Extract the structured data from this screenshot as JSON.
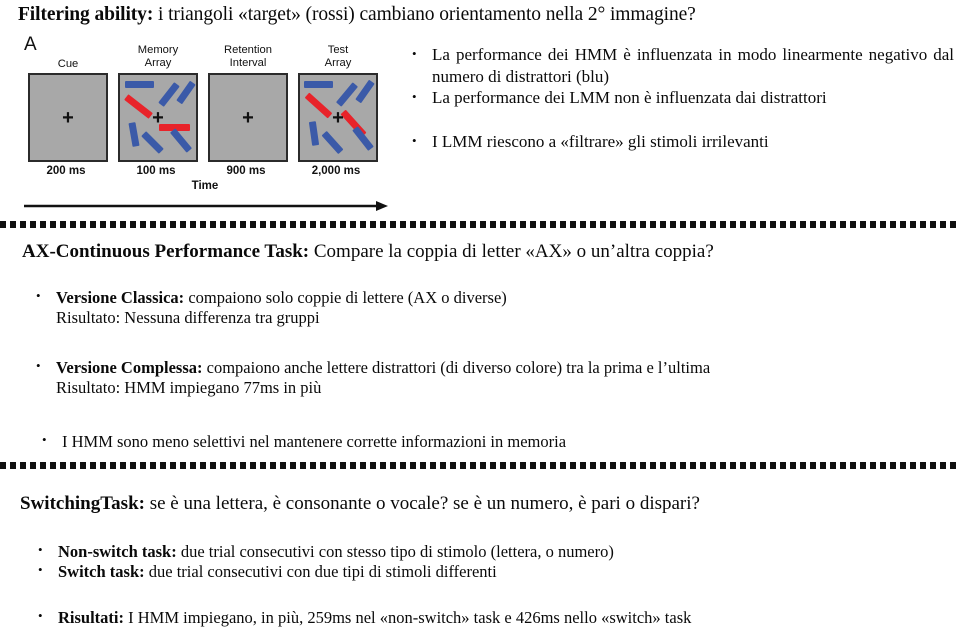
{
  "slide": {
    "title_bold": "Filtering ability:",
    "title_rest": " i triangoli «target» (rossi)  cambiano orientamento nella 2° immagine?"
  },
  "figure": {
    "panel_letter": "A",
    "colors": {
      "panel_background": "#a8a8a8",
      "panel_border": "#2b2b2b",
      "distractor_blue": "#3b5aa8",
      "target_red": "#e8232a",
      "fixation": "#111111"
    },
    "panels": [
      {
        "caption": "Cue",
        "duration": "200 ms"
      },
      {
        "caption": "Memory\nArray",
        "caption_line1": "Memory",
        "caption_line2": "Array",
        "duration": "100 ms"
      },
      {
        "caption": "Retention\nInterval",
        "caption_line1": "Retention",
        "caption_line2": "Interval",
        "duration": "900 ms"
      },
      {
        "caption": "Test\nArray",
        "caption_line1": "Test",
        "caption_line2": "Array",
        "duration": "2,000 ms"
      }
    ],
    "axis_label": "Time",
    "fixation_glyph": "+"
  },
  "filtering_bullets": {
    "items": [
      "La performance dei HMM è influenzata in modo linearmente negativo dal numero di distrattori (blu)",
      "La performance dei LMM non è influenzata dai distrattori",
      "I LMM riescono a «filtrare» gli stimoli irrilevanti"
    ]
  },
  "axcpt": {
    "heading_bold": "AX-Continuous Performance Task:",
    "heading_rest": " Compare la coppia di letter «AX» o un’altra coppia?",
    "items": [
      {
        "bold": "Versione Classica:",
        "rest": " compaiono solo coppie di lettere (AX o diverse)",
        "sub": "Risultato: Nessuna differenza tra gruppi"
      },
      {
        "bold": "Versione Complessa:",
        "rest": " compaiono anche lettere distrattori (di diverso colore) tra la prima e l’ultima",
        "sub": "Risultato: HMM impiegano 77ms in più"
      },
      {
        "bold": "",
        "rest": "I HMM sono meno selettivi nel mantenere corrette informazioni in memoria",
        "sub": ""
      }
    ]
  },
  "switching": {
    "heading_bold": "SwitchingTask:",
    "heading_rest": " se è una lettera, è consonante o vocale? se è un numero, è pari o dispari?",
    "items": [
      {
        "bold": "Non-switch task:",
        "rest": " due trial consecutivi con stesso tipo di stimolo (lettera, o numero)"
      },
      {
        "bold": "Switch task:",
        "rest": " due trial consecutivi con due tipi di stimoli differenti"
      }
    ],
    "result": {
      "bold": "Risultati:",
      "rest": " I HMM impiegano, in più, 259ms nel «non-switch» task e 426ms nello «switch» task"
    }
  }
}
